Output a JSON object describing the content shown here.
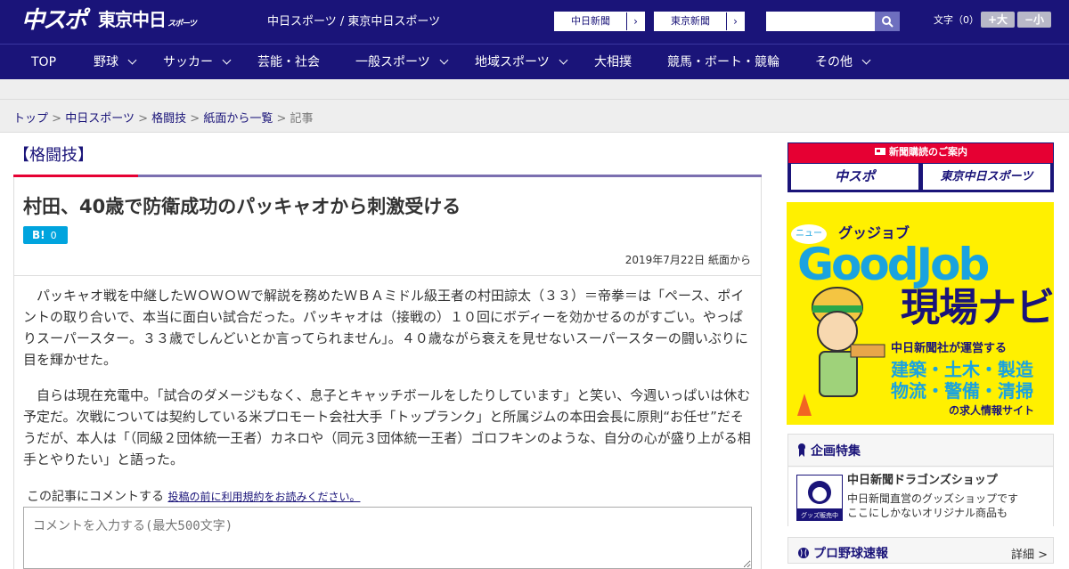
{
  "header": {
    "logo_main": "中スポ",
    "logo_tokyo": "東京中日",
    "logo_tokyo_sub": "スポーツ",
    "site_names": "中日スポーツ / 東京中日スポーツ",
    "links": [
      {
        "label": "中日新聞",
        "arrow": "›"
      },
      {
        "label": "東京新聞",
        "arrow": "›"
      }
    ],
    "search": {
      "placeholder": ""
    },
    "fontsize_label": "文字（0）",
    "fontsize_up": "+大",
    "fontsize_down": "−小"
  },
  "nav": {
    "items": [
      {
        "label": "TOP",
        "dropdown": false
      },
      {
        "label": "野球",
        "dropdown": true
      },
      {
        "label": "サッカー",
        "dropdown": true
      },
      {
        "label": "芸能・社会",
        "dropdown": false
      },
      {
        "label": "一般スポーツ",
        "dropdown": true
      },
      {
        "label": "地域スポーツ",
        "dropdown": true
      },
      {
        "label": "大相撲",
        "dropdown": false
      },
      {
        "label": "競馬・ボート・競輪",
        "dropdown": false
      },
      {
        "label": "その他",
        "dropdown": true
      }
    ]
  },
  "breadcrumb": {
    "items": [
      "トップ",
      "中日スポーツ",
      "格闘技",
      "紙面から一覧"
    ],
    "separator": ">",
    "current": "記事"
  },
  "article": {
    "category": "【格闘技】",
    "headline": "村田、40歳で防衛成功のパッキャオから刺激受ける",
    "hatena_label": "B!",
    "hatena_count": "0",
    "date": "2019年7月22日 紙面から",
    "paragraphs": [
      "パッキャオ戦を中継したＷＯＷＯＷで解説を務めたＷＢＡミドル級王者の村田諒太（３３）＝帝拳＝は「ペース、ポイントの取り合いで、本当に面白い試合だった。パッキャオは（接戦の）１０回にボディーを効かせるのがすごい。やっぱりスーパースター。３３歳でしんどいとか言ってられません」。４０歳ながら衰えを見せないスーパースターの闘いぶりに目を輝かせた。",
      "自らは現在充電中。「試合のダメージもなく、息子とキャッチボールをしたりしています」と笑い、今週いっぱいは休む予定だ。次戦については契約している米プロモート会社大手「トップランク」と所属ジムの本田会長に原則“お任せ”だそうだが、本人は「（同級２団体統一王者）カネロや（同元３団体統一王者）ゴロフキンのような、自分の心が盛り上がる相手とやりたい」と語った。"
    ],
    "comment_label": "この記事にコメントする",
    "comment_terms_link": "投稿の前に利用規約をお読みください。",
    "comment_placeholder": "コメントを入力する(最大500文字)"
  },
  "sidebar": {
    "subscription": {
      "title": "新聞購読のご案内",
      "btn1": "中スポ",
      "btn2": "東京中日スポーツ"
    },
    "ad": {
      "tag": "ニュー",
      "kana": "グッジョブ",
      "title": "GoodJob",
      "subtitle": "現場ナビ",
      "operator": "中日新聞社が運営する",
      "industries1": "建築・土木・製造",
      "industries2": "物流・警備・清掃",
      "site": "の求人情報サイト"
    },
    "feature": {
      "title": "企画特集",
      "item_title": "中日新聞ドラゴンズショップ",
      "item_desc1": "中日新聞直営のグッズショップです",
      "item_desc2": "ここにしかないオリジナル商品も",
      "thumb_label": "グッズ販売中"
    },
    "pro_baseball": {
      "title": "プロ野球速報",
      "more": "詳細 >"
    }
  },
  "colors": {
    "brand": "#1a1479",
    "accent_red": "#e60033",
    "hatena_blue": "#00a4de",
    "ad_yellow": "#fff000"
  }
}
